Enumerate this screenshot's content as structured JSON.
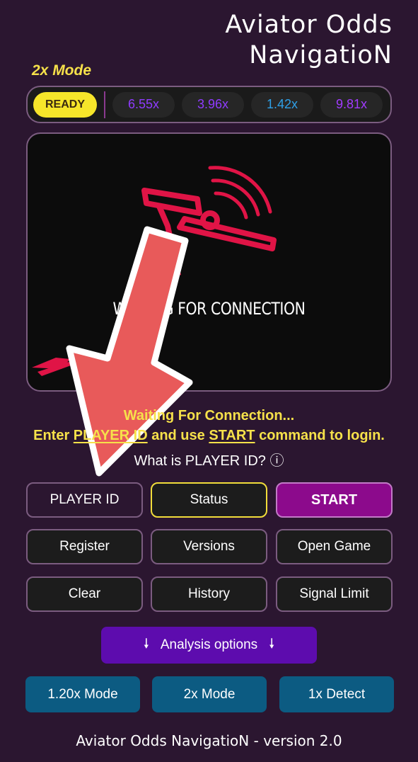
{
  "app": {
    "title_line1": "Aviator Odds",
    "title_line2": "NavigatioN"
  },
  "mode_label": "2x Mode",
  "odds_bar": {
    "ready": "READY",
    "chips": [
      {
        "value": "6.55x",
        "color": "#8f3bff"
      },
      {
        "value": "3.96x",
        "color": "#8f3bff"
      },
      {
        "value": "1.42x",
        "color": "#2fa0e8"
      },
      {
        "value": "9.81x",
        "color": "#a13bff"
      }
    ]
  },
  "screen": {
    "connection_text": "WAITING FOR CONNECTION"
  },
  "status": {
    "message": "Waiting For Connection...",
    "instr_prefix": "Enter ",
    "instr_player_id": "PLAYER ID",
    "instr_mid": " and use ",
    "instr_start": "START",
    "instr_suffix": " command to login.",
    "help_text": "What is PLAYER ID? ⓘ"
  },
  "buttons": {
    "player_id": "PLAYER ID",
    "status": "Status",
    "start": "START",
    "register": "Register",
    "versions": "Versions",
    "open_game": "Open Game",
    "clear": "Clear",
    "history": "History",
    "signal_limit": "Signal Limit"
  },
  "analysis": {
    "label": "Analysis options",
    "arrow": "🠗"
  },
  "modes": {
    "m120": "1.20x Mode",
    "m2": "2x Mode",
    "detect": "1x Detect"
  },
  "footer": "Aviator Odds NavigatioN -  version 2.0",
  "colors": {
    "background": "#2b1630",
    "accent_yellow": "#f6e14a",
    "start_purple": "#8c0a8c",
    "analysis_purple": "#5d0cae",
    "mode_blue": "#0c5b82",
    "plane_red": "#e01446",
    "arrow_red": "#e85a5a"
  }
}
